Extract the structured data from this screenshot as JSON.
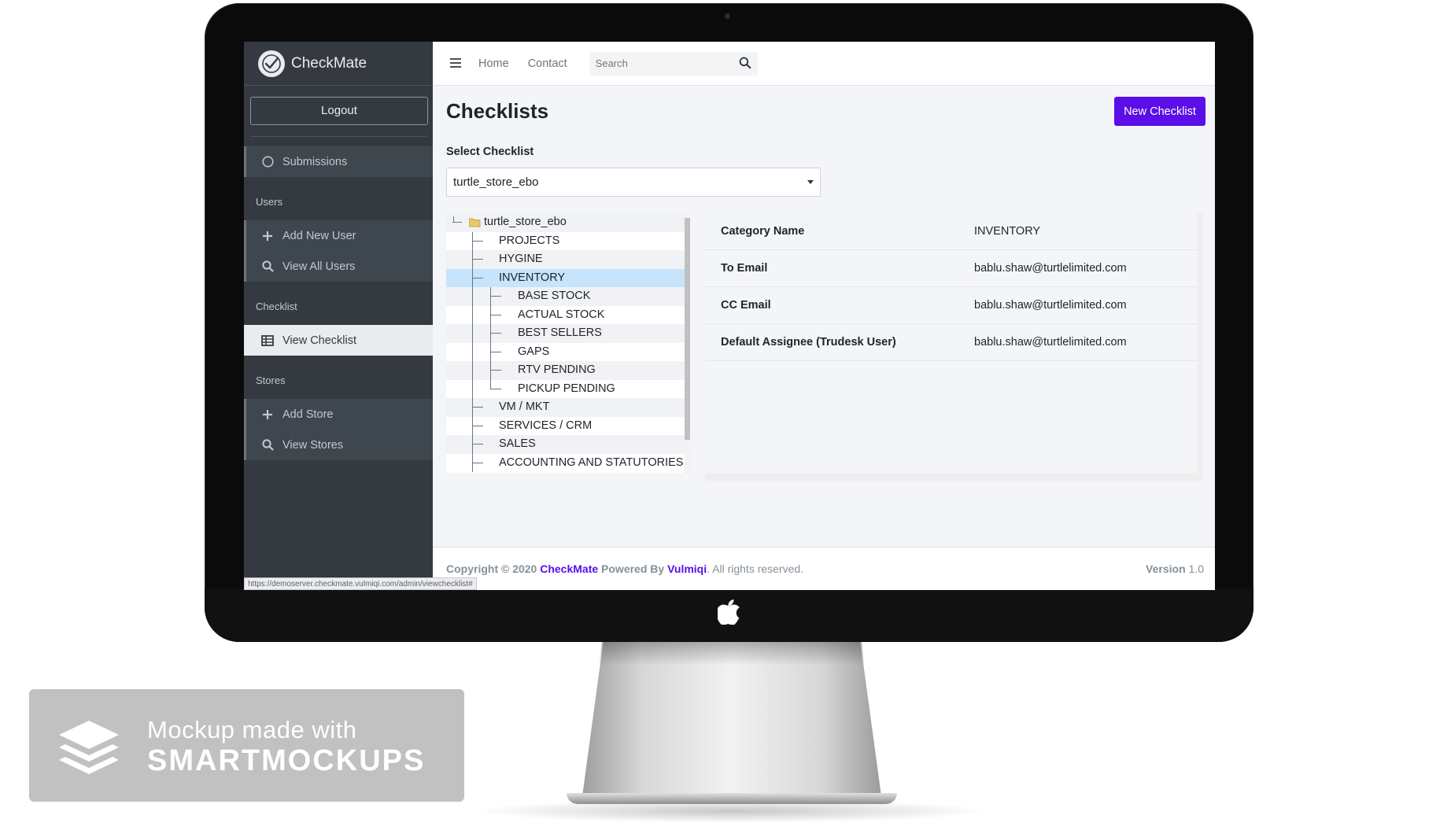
{
  "brand": {
    "name_light": "Check",
    "name_bold": "Mate"
  },
  "sidebar": {
    "logout_label": "Logout",
    "submissions_label": "Submissions",
    "sections": [
      {
        "header": "Users",
        "items": [
          {
            "label": "Add New User",
            "icon": "plus-icon"
          },
          {
            "label": "View All Users",
            "icon": "search-icon"
          }
        ]
      },
      {
        "header": "Checklist",
        "items": [
          {
            "label": "View Checklist",
            "icon": "table-icon",
            "active": true
          }
        ]
      },
      {
        "header": "Stores",
        "items": [
          {
            "label": "Add Store",
            "icon": "plus-icon"
          },
          {
            "label": "View Stores",
            "icon": "search-icon"
          }
        ]
      }
    ]
  },
  "topbar": {
    "home_label": "Home",
    "contact_label": "Contact",
    "search_placeholder": "Search"
  },
  "main": {
    "title": "Checklists",
    "new_button_label": "New Checklist",
    "select_label": "Select Checklist",
    "selected_checklist": "turtle_store_ebo"
  },
  "tree": {
    "root": "turtle_store_ebo",
    "nodes": [
      {
        "label": "PROJECTS",
        "level": 1
      },
      {
        "label": "HYGINE",
        "level": 1
      },
      {
        "label": "INVENTORY",
        "level": 1,
        "selected": true,
        "expanded": true
      },
      {
        "label": "BASE STOCK",
        "level": 2
      },
      {
        "label": "ACTUAL STOCK",
        "level": 2
      },
      {
        "label": "BEST SELLERS",
        "level": 2
      },
      {
        "label": "GAPS",
        "level": 2
      },
      {
        "label": "RTV PENDING",
        "level": 2
      },
      {
        "label": "PICKUP PENDING",
        "level": 2
      },
      {
        "label": "VM / MKT",
        "level": 1
      },
      {
        "label": "SERVICES / CRM",
        "level": 1
      },
      {
        "label": "SALES",
        "level": 1
      },
      {
        "label": "ACCOUNTING AND STATUTORIES",
        "level": 1
      }
    ]
  },
  "details": [
    {
      "key": "Category Name",
      "value": "INVENTORY"
    },
    {
      "key": "To Email",
      "value": "bablu.shaw@turtlelimited.com"
    },
    {
      "key": "CC Email",
      "value": "bablu.shaw@turtlelimited.com"
    },
    {
      "key": "Default Assignee (Trudesk User)",
      "value": "bablu.shaw@turtlelimited.com"
    }
  ],
  "footer": {
    "copyright_prefix": "Copyright © 2020",
    "app_name": "CheckMate",
    "powered_by": "Powered By",
    "company": "Vulmiqi",
    "rights": ". All rights reserved.",
    "version_label": "Version",
    "version_value": "1.0"
  },
  "status_url": "https://demoserver.checkmate.vulmiqi.com/admin/viewchecklist#",
  "watermark": {
    "line1": "Mockup made with",
    "line2": "SMARTMOCKUPS"
  },
  "colors": {
    "accent": "#5b0ee8",
    "sidebar_bg": "#343a40",
    "tree_selected": "#c6e4fb"
  }
}
